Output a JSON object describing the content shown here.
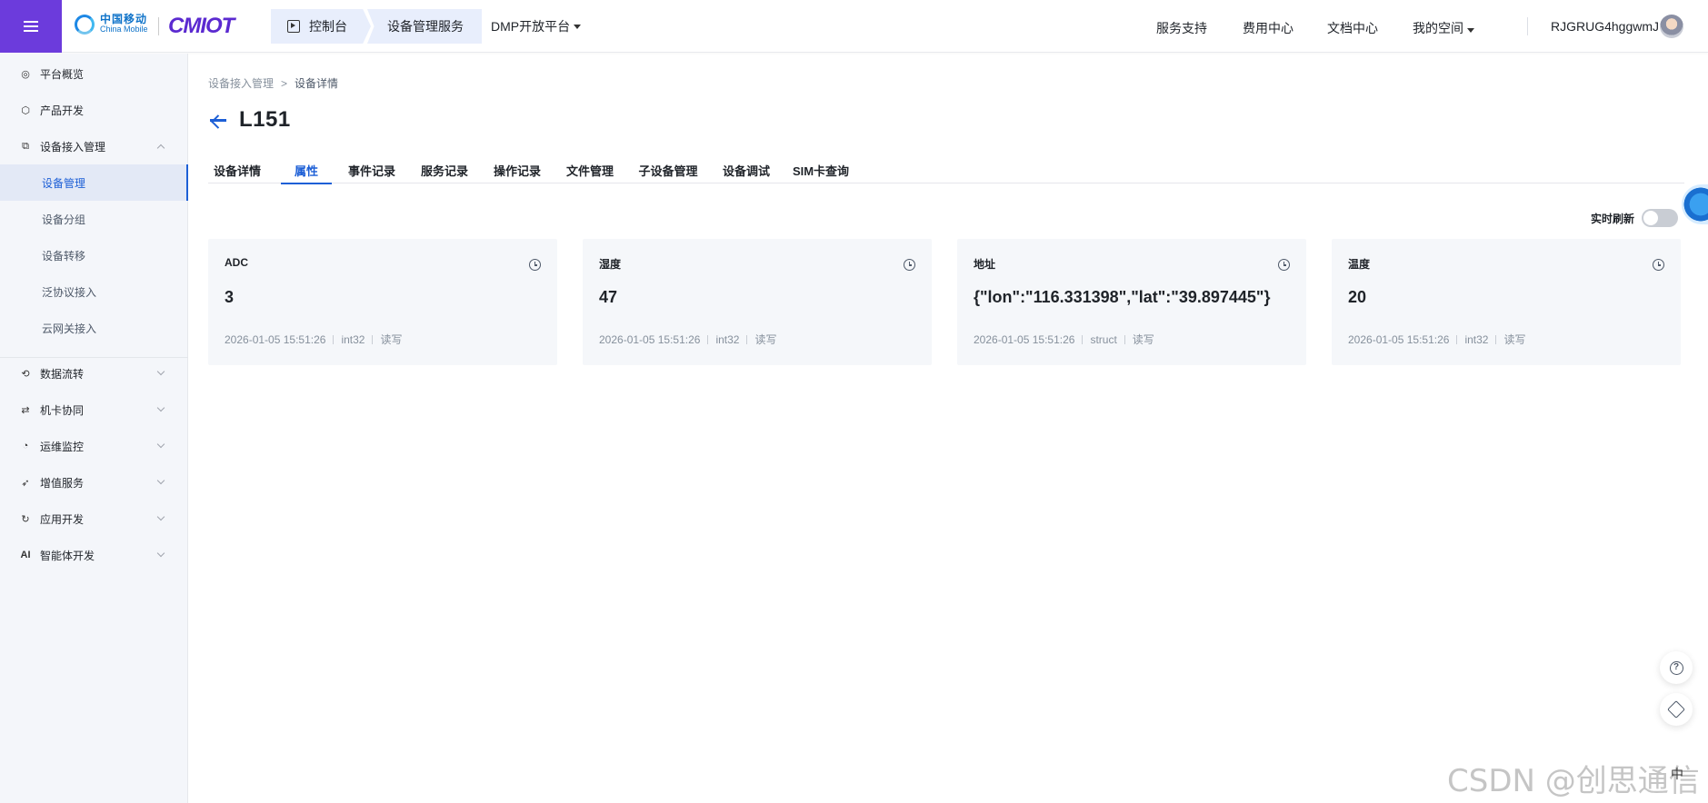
{
  "header": {
    "logo_cn": "中国移动",
    "logo_en": "China Mobile",
    "logo_brand": "CMIOT",
    "crumbs": [
      "控制台",
      "设备管理服务",
      "DMP开放平台"
    ],
    "right_nav": [
      "服务支持",
      "费用中心",
      "文档中心",
      "我的空间"
    ],
    "user": "RJGRUG4hggwmJ"
  },
  "sidebar": {
    "items": [
      {
        "label": "平台概览",
        "icon": "overview-icon"
      },
      {
        "label": "产品开发",
        "icon": "product-icon"
      },
      {
        "label": "设备接入管理",
        "icon": "device-access-icon"
      },
      {
        "label": "数据流转",
        "icon": "data-flow-icon"
      },
      {
        "label": "机卡协同",
        "icon": "card-sync-icon"
      },
      {
        "label": "运维监控",
        "icon": "monitor-icon"
      },
      {
        "label": "增值服务",
        "icon": "value-added-icon"
      },
      {
        "label": "应用开发",
        "icon": "app-dev-icon"
      },
      {
        "label": "智能体开发",
        "icon": "ai-icon"
      }
    ],
    "sub_items": [
      "设备管理",
      "设备分组",
      "设备转移",
      "泛协议接入",
      "云网关接入"
    ]
  },
  "breadcrumb": {
    "parent": "设备接入管理",
    "sep": ">",
    "current": "设备详情"
  },
  "page_title": "L151",
  "tabs": [
    "设备详情",
    "属性",
    "事件记录",
    "服务记录",
    "操作记录",
    "文件管理",
    "子设备管理",
    "设备调试",
    "SIM卡查询"
  ],
  "active_tab": "属性",
  "refresh_label": "实时刷新",
  "cards": [
    {
      "name": "ADC",
      "value": "3",
      "time": "2026-01-05 15:51:26",
      "type": "int32",
      "access": "读写"
    },
    {
      "name": "湿度",
      "value": "47",
      "time": "2026-01-05 15:51:26",
      "type": "int32",
      "access": "读写"
    },
    {
      "name": "地址",
      "value": "{\"lon\":\"116.331398\",\"lat\":\"39.897445\"}",
      "time": "2026-01-05 15:51:26",
      "type": "struct",
      "access": "读写"
    },
    {
      "name": "温度",
      "value": "20",
      "time": "2026-01-05 15:51:26",
      "type": "int32",
      "access": "读写"
    }
  ],
  "watermark": "CSDN @创思通信",
  "lang_badge": "中",
  "colors": {
    "brand_purple": "#6c3bdc",
    "accent_blue": "#1d5fd6"
  }
}
